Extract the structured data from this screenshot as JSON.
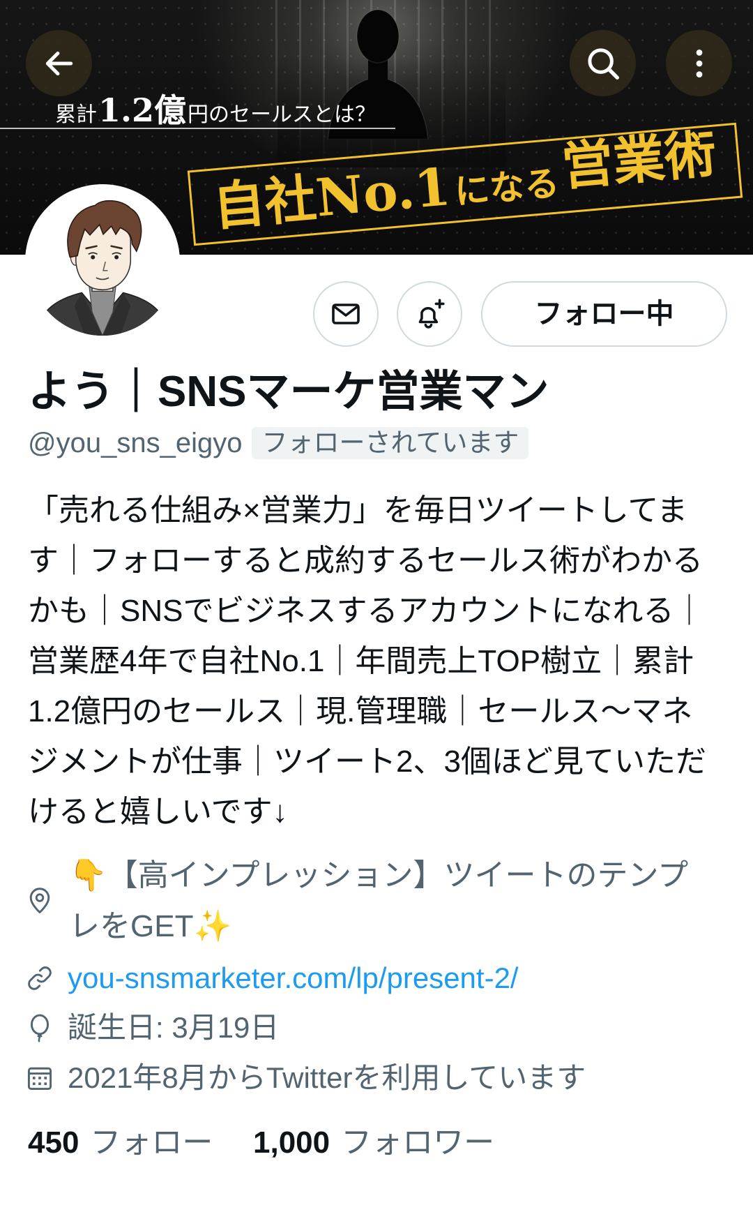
{
  "nav": {
    "back_icon": "arrow-left-icon",
    "search_icon": "search-icon",
    "more_icon": "more-vertical-icon"
  },
  "banner": {
    "tagline_prefix": "累計",
    "tagline_amount": "1.2億",
    "tagline_suffix": "円のセールスとは？",
    "headline_main": "自社No.1",
    "headline_mid": "になる",
    "headline_end": "営業術",
    "accent_color": "#f2c12e"
  },
  "actions": {
    "message_icon": "mail-icon",
    "notifications_icon": "bell-plus-icon",
    "follow_label": "フォロー中"
  },
  "profile": {
    "display_name": "よう｜SNSマーケ営業マン",
    "handle": "@you_sns_eigyo",
    "follows_you_badge": "フォローされています",
    "bio_lines": [
      "「売れる仕組み×営業力」を毎日ツイートしてま",
      "す｜フォローすると成約するセールス術がわかる",
      "かも｜SNSでビジネスするアカウントになれる｜",
      "営業歴4年で自社No.1｜年間売上TOP樹立｜累計",
      "1.2億円のセールス｜現.管理職｜セールス〜マネ",
      "ジメントが仕事｜ツイート2、3個ほど見ていただ",
      "けると嬉しいです↓"
    ],
    "location_icon": "location-pin-icon",
    "location_lines": [
      "👇【高インプレッション】ツイートのテンプ",
      "レをGET✨"
    ],
    "website_icon": "link-icon",
    "website": "you-snsmarketer.com/lp/present-2/",
    "birthday_icon": "balloon-icon",
    "birthday": "誕生日: 3月19日",
    "joined_icon": "calendar-icon",
    "joined": "2021年8月からTwitterを利用しています"
  },
  "stats": {
    "following_count": "450",
    "following_label": "フォロー",
    "followers_count": "1,000",
    "followers_label": "フォロワー"
  },
  "colors": {
    "text_primary": "#0f1419",
    "text_secondary": "#536471",
    "link": "#1d9bf0",
    "border": "#cfd9de",
    "badge_background": "#eff3f4"
  }
}
